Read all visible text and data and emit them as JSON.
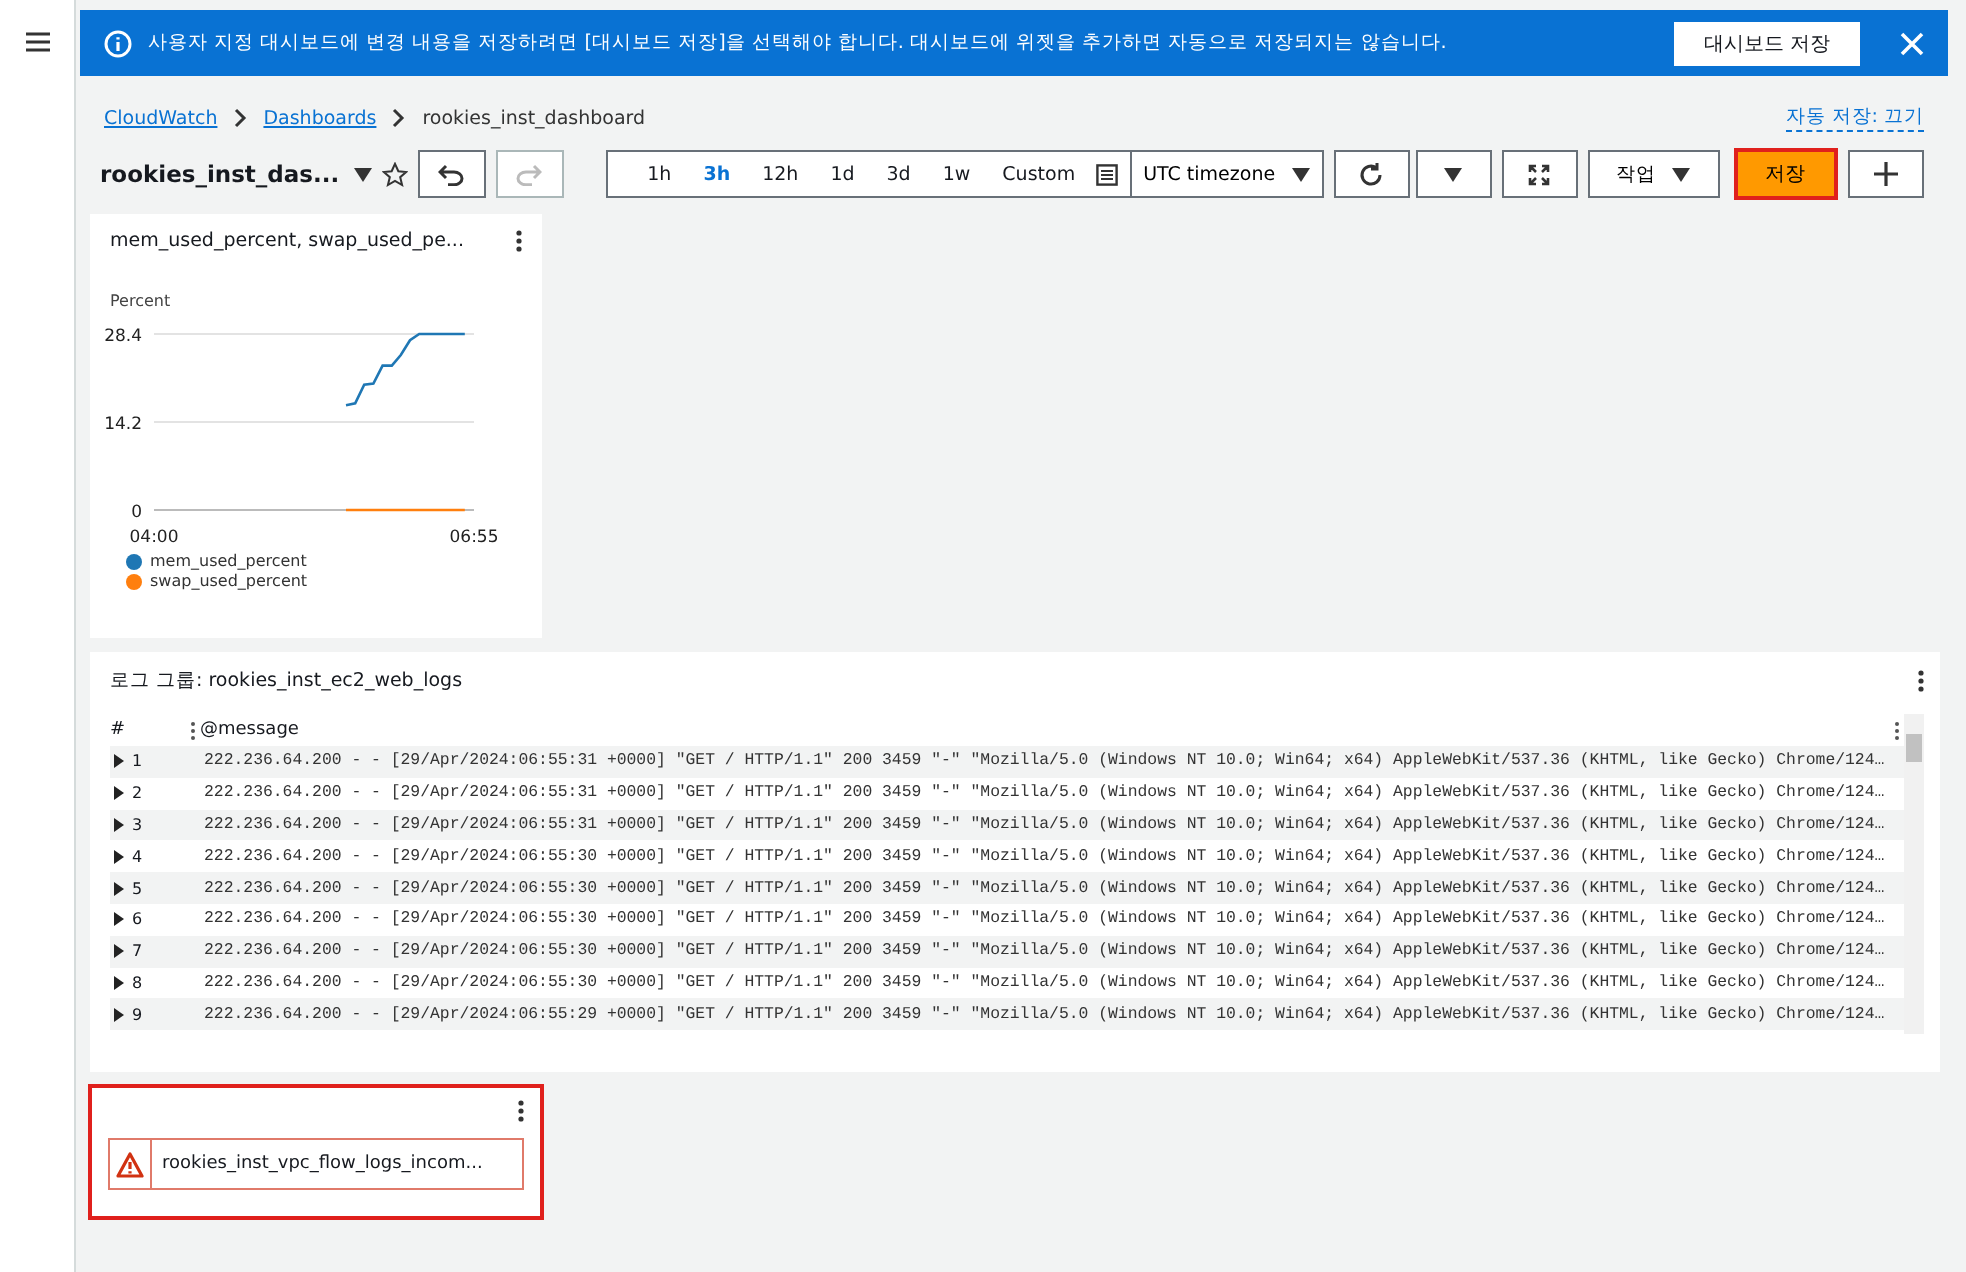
{
  "flash": {
    "message": "사용자 지정 대시보드에 변경 내용을 저장하려면 [대시보드 저장]을 선택해야 합니다. 대시보드에 위젯을 추가하면 자동으로 저장되지는 않습니다.",
    "button": "대시보드 저장"
  },
  "breadcrumbs": [
    {
      "label": "CloudWatch",
      "link": true
    },
    {
      "label": "Dashboards",
      "link": true
    },
    {
      "label": "rookies_inst_dashboard",
      "link": false
    }
  ],
  "autosave": "자동 저장: 끄기",
  "title": "rookies_inst_das...",
  "redo_disabled": true,
  "time_ranges": [
    {
      "label": "1h",
      "selected": false
    },
    {
      "label": "3h",
      "selected": true
    },
    {
      "label": "12h",
      "selected": false
    },
    {
      "label": "1d",
      "selected": false
    },
    {
      "label": "3d",
      "selected": false
    },
    {
      "label": "1w",
      "selected": false
    },
    {
      "label": "Custom",
      "selected": false
    }
  ],
  "timezone": "UTC timezone",
  "actions_label": "작업",
  "save_label": "저장",
  "chart_widget": {
    "title": "mem_used_percent, swap_used_pe...",
    "chart_data": {
      "type": "line",
      "ylabel": "Percent",
      "categories": [
        "04:00",
        null,
        null,
        null,
        null,
        null,
        null,
        null,
        null,
        null,
        null,
        null,
        null,
        null,
        null,
        null,
        null,
        null,
        null,
        null,
        null,
        null,
        null,
        null,
        null,
        null,
        null,
        null,
        null,
        null,
        null,
        null,
        null,
        null,
        null,
        "06:55"
      ],
      "ylim": [
        0,
        28.4
      ],
      "yticks": [
        0,
        14.2,
        28.4
      ],
      "series": [
        {
          "name": "mem_used_percent",
          "color": "#1f77b4",
          "values": [
            null,
            null,
            null,
            null,
            null,
            null,
            null,
            null,
            null,
            null,
            null,
            null,
            null,
            null,
            null,
            null,
            null,
            null,
            null,
            null,
            null,
            16.9,
            17.2,
            20.2,
            20.4,
            23.3,
            23.3,
            25.0,
            27.4,
            28.4,
            28.4,
            28.4,
            28.4,
            28.4,
            28.4,
            null
          ]
        },
        {
          "name": "swap_used_percent",
          "color": "#ff7f0e",
          "values": [
            null,
            null,
            null,
            null,
            null,
            null,
            null,
            null,
            null,
            null,
            null,
            null,
            null,
            null,
            null,
            null,
            null,
            null,
            null,
            null,
            null,
            0,
            0,
            0,
            0,
            0,
            0,
            0,
            0,
            0,
            0,
            0,
            0,
            0,
            0,
            null
          ]
        }
      ]
    }
  },
  "log_widget": {
    "title": "로그 그룹: rookies_inst_ec2_web_logs",
    "columns": [
      "#",
      "@message"
    ],
    "rows": [
      {
        "num": "1",
        "expanded": false,
        "message": "222.236.64.200 - - [29/Apr/2024:06:55:31 +0000] \"GET / HTTP/1.1\" 200 3459 \"-\" \"Mozilla/5.0 (Windows NT 10.0; Win64; x64) AppleWebKit/537.36 (KHTML, like Gecko) Chrome/124…"
      },
      {
        "num": "2",
        "expanded": false,
        "message": "222.236.64.200 - - [29/Apr/2024:06:55:31 +0000] \"GET / HTTP/1.1\" 200 3459 \"-\" \"Mozilla/5.0 (Windows NT 10.0; Win64; x64) AppleWebKit/537.36 (KHTML, like Gecko) Chrome/124…"
      },
      {
        "num": "3",
        "expanded": false,
        "message": "222.236.64.200 - - [29/Apr/2024:06:55:31 +0000] \"GET / HTTP/1.1\" 200 3459 \"-\" \"Mozilla/5.0 (Windows NT 10.0; Win64; x64) AppleWebKit/537.36 (KHTML, like Gecko) Chrome/124…"
      },
      {
        "num": "4",
        "expanded": false,
        "message": "222.236.64.200 - - [29/Apr/2024:06:55:30 +0000] \"GET / HTTP/1.1\" 200 3459 \"-\" \"Mozilla/5.0 (Windows NT 10.0; Win64; x64) AppleWebKit/537.36 (KHTML, like Gecko) Chrome/124…"
      },
      {
        "num": "5",
        "expanded": false,
        "message": "222.236.64.200 - - [29/Apr/2024:06:55:30 +0000] \"GET / HTTP/1.1\" 200 3459 \"-\" \"Mozilla/5.0 (Windows NT 10.0; Win64; x64) AppleWebKit/537.36 (KHTML, like Gecko) Chrome/124…"
      },
      {
        "num": "6",
        "expanded": false,
        "message": "222.236.64.200 - - [29/Apr/2024:06:55:30 +0000] \"GET / HTTP/1.1\" 200 3459 \"-\" \"Mozilla/5.0 (Windows NT 10.0; Win64; x64) AppleWebKit/537.36 (KHTML, like Gecko) Chrome/124…"
      },
      {
        "num": "7",
        "expanded": false,
        "message": "222.236.64.200 - - [29/Apr/2024:06:55:30 +0000] \"GET / HTTP/1.1\" 200 3459 \"-\" \"Mozilla/5.0 (Windows NT 10.0; Win64; x64) AppleWebKit/537.36 (KHTML, like Gecko) Chrome/124…"
      },
      {
        "num": "8",
        "expanded": false,
        "message": "222.236.64.200 - - [29/Apr/2024:06:55:30 +0000] \"GET / HTTP/1.1\" 200 3459 \"-\" \"Mozilla/5.0 (Windows NT 10.0; Win64; x64) AppleWebKit/537.36 (KHTML, like Gecko) Chrome/124…"
      },
      {
        "num": "9",
        "expanded": false,
        "message": "222.236.64.200 - - [29/Apr/2024:06:55:29 +0000] \"GET / HTTP/1.1\" 200 3459 \"-\" \"Mozilla/5.0 (Windows NT 10.0; Win64; x64) AppleWebKit/537.36 (KHTML, like Gecko) Chrome/124…"
      }
    ]
  },
  "error_widget": {
    "message": "rookies_inst_vpc_flow_logs_incom..."
  }
}
